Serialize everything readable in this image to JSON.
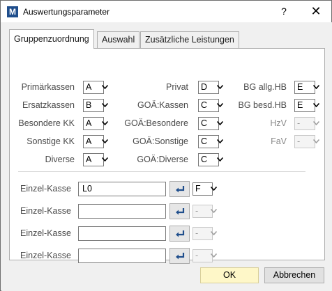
{
  "window": {
    "title": "Auswertungsparameter",
    "help_label": "?",
    "close_label": "✕"
  },
  "tabs": [
    {
      "label": "Gruppenzuordnung",
      "active": true
    },
    {
      "label": "Auswahl",
      "active": false
    },
    {
      "label": "Zusätzliche Leistungen",
      "active": false
    }
  ],
  "col1": [
    {
      "label": "Primärkassen",
      "value": "A"
    },
    {
      "label": "Ersatzkassen",
      "value": "B"
    },
    {
      "label": "Besondere KK",
      "value": "A"
    },
    {
      "label": "Sonstige  KK",
      "value": "A"
    },
    {
      "label": "Diverse",
      "value": "A"
    }
  ],
  "col2": [
    {
      "label": "Privat",
      "value": "D"
    },
    {
      "label": "GOÄ:Kassen",
      "value": "C"
    },
    {
      "label": "GOÄ:Besondere",
      "value": "C"
    },
    {
      "label": "GOÄ:Sonstige",
      "value": "C"
    },
    {
      "label": "GOÄ:Diverse",
      "value": "C"
    }
  ],
  "col3": [
    {
      "label": "BG allg.HB",
      "value": "E",
      "disabled": false
    },
    {
      "label": "BG besd.HB",
      "value": "E",
      "disabled": false
    },
    {
      "label": "HzV",
      "value": "-",
      "disabled": true
    },
    {
      "label": "FaV",
      "value": "-",
      "disabled": true
    }
  ],
  "einzel": [
    {
      "label": "Einzel-Kasse",
      "text": "L0",
      "group": "F",
      "disabled": false
    },
    {
      "label": "Einzel-Kasse",
      "text": "",
      "group": "-",
      "disabled": true
    },
    {
      "label": "Einzel-Kasse",
      "text": "",
      "group": "-",
      "disabled": true
    },
    {
      "label": "Einzel-Kasse",
      "text": "",
      "group": "-",
      "disabled": true
    }
  ],
  "buttons": {
    "ok": "OK",
    "cancel": "Abbrechen"
  },
  "colors": {
    "ok_bg": "#fef7c8",
    "app_icon": "#1f4e8c",
    "enter_arrow": "#1f4e8c"
  }
}
